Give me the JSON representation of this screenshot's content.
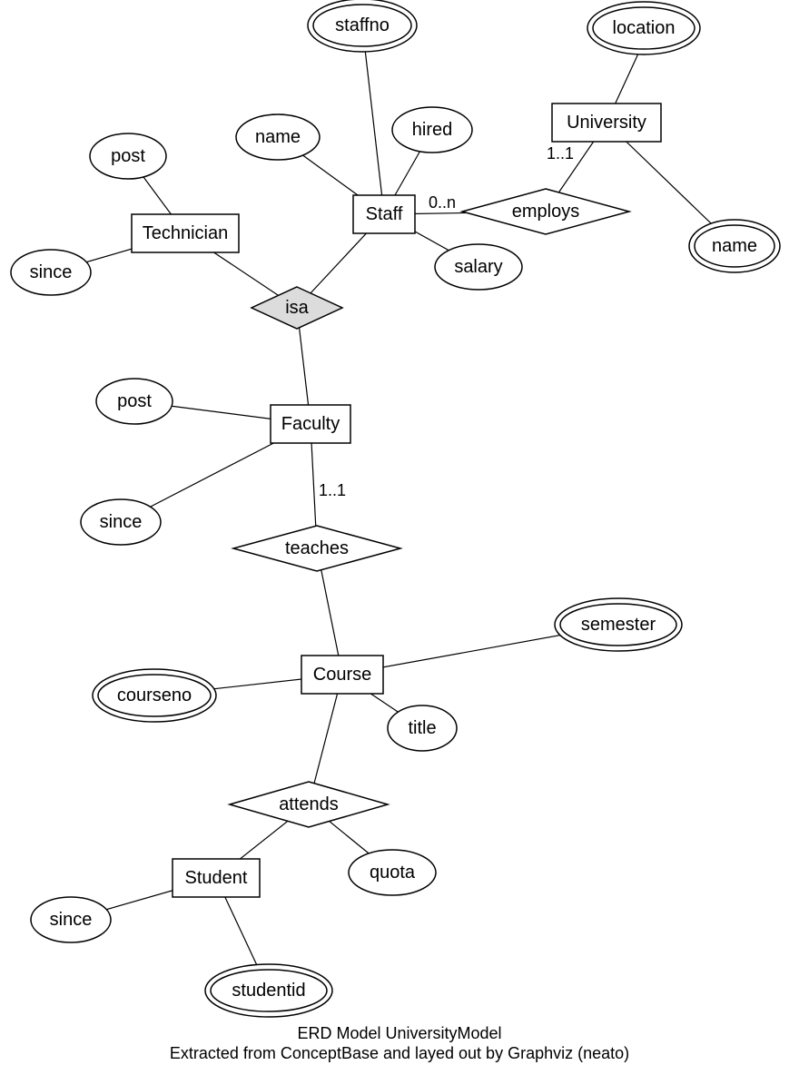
{
  "title": "ERD Model UniversityModel",
  "caption_line1": "ERD Model UniversityModel",
  "caption_line2": "Extracted from ConceptBase and layed out by Graphviz (neato)",
  "entities": {
    "university": "University",
    "staff": "Staff",
    "technician": "Technician",
    "faculty": "Faculty",
    "course": "Course",
    "student": "Student"
  },
  "relationships": {
    "employs": "employs",
    "isa": "isa",
    "teaches": "teaches",
    "attends": "attends"
  },
  "attributes": {
    "univ_location": "location",
    "univ_name": "name",
    "staff_name": "name",
    "staff_staffno": "staffno",
    "staff_hired": "hired",
    "staff_salary": "salary",
    "tech_post": "post",
    "tech_since": "since",
    "fac_post": "post",
    "fac_since": "since",
    "course_courseno": "courseno",
    "course_semester": "semester",
    "course_title": "title",
    "attends_quota": "quota",
    "student_since": "since",
    "student_studentid": "studentid"
  },
  "cardinalities": {
    "employs_univ": "1..1",
    "employs_staff": "0..n",
    "teaches_fac": "1..1"
  }
}
